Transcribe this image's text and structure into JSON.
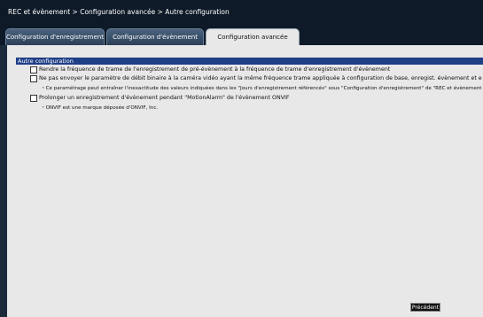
{
  "breadcrumb": "REC et évènement > Configuration avancée > Autre configuration",
  "tabs": [
    {
      "label": "Configuration d'enregistrement",
      "active": false
    },
    {
      "label": "Configuration d'évènement",
      "active": false
    },
    {
      "label": "Configuration avancée",
      "active": true
    }
  ],
  "section": {
    "title": "Autre configuration",
    "options": [
      {
        "label": "Rendre la fréquence de trame de l'enregistrement de pré-évènement à la fréquence de trame d'enregistrement d'évènement",
        "checked": false
      },
      {
        "label": "Ne pas envoyer le paramètre de débit binaire à la caméra vidéo ayant la même fréquence trame appliquée à configuration de base, enregist. évènement et enregist. urgence",
        "checked": false,
        "note": "・Ce paramétrage peut entraîner l'inexactitude des valeurs indiquées dans les \"Jours d'enregistrement référencés\" sous \"Configuration d'enregistrement\" de \"REC et évènement\""
      },
      {
        "label": "Prolonger un enregistrement d'évènement pendant \"MotionAlarm\" de l'évènement ONVIF",
        "checked": false,
        "note": "・ONVIF est une marque déposée d'ONVIF, Inc."
      }
    ]
  },
  "buttons": {
    "previous": "Précédent"
  },
  "colors": {
    "background": "#1c2b3c",
    "panel": "#e8e8e8",
    "section_header": "#1f3f86"
  }
}
